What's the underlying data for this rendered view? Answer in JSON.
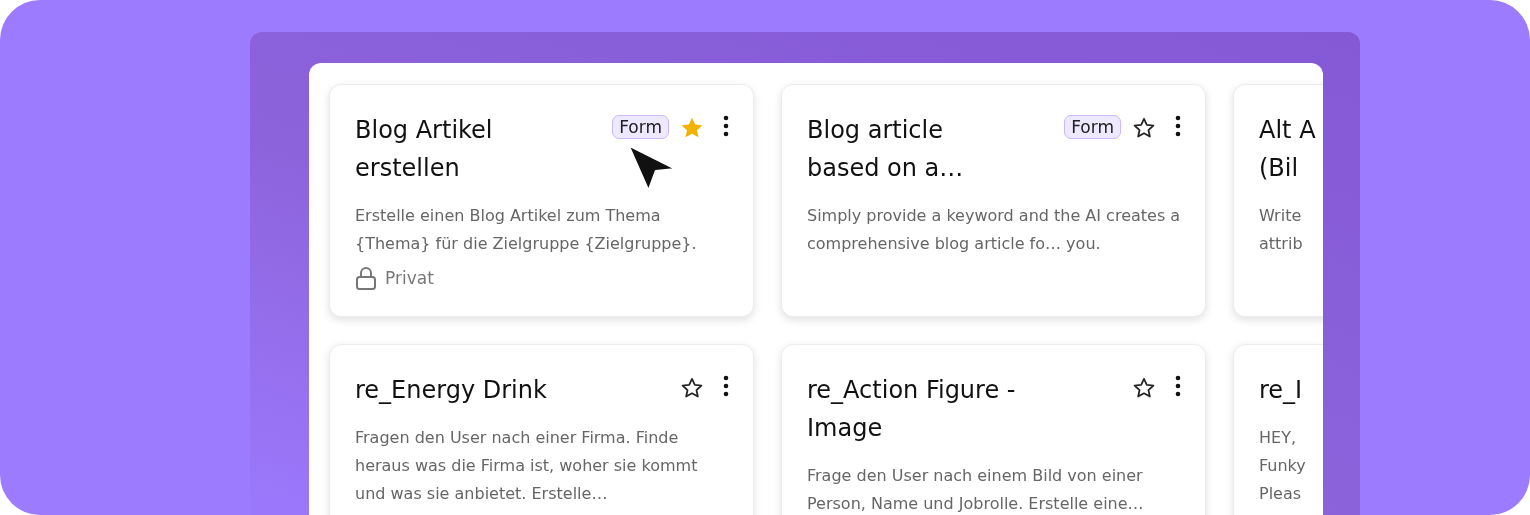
{
  "cards": [
    {
      "title": "Blog Artikel erstellen",
      "tag": "Form",
      "favorite": true,
      "description": "Erstelle einen Blog Artikel zum Thema {Thema} für die Zielgruppe {Zielgruppe}.",
      "visibility": "Privat"
    },
    {
      "title": "Blog article based on a…",
      "tag": "Form",
      "favorite": false,
      "description": "Simply provide a keyword and the AI creates a comprehensive blog article fo… you."
    },
    {
      "title_lines": [
        "Alt A",
        "(Bil"
      ],
      "description_lines": [
        "Write",
        "attrib"
      ]
    },
    {
      "title": "re_Energy Drink",
      "favorite": false,
      "description": "Fragen den User nach einer Firma. Finde heraus was die Firma ist, woher sie kommt und was sie anbietet. Erstelle…"
    },
    {
      "title": "re_Action Figure - Image",
      "favorite": false,
      "description": "Frage den User nach einem Bild von einer Person, Name und Jobrolle. Erstelle eine…"
    },
    {
      "title_lines": [
        "re_I"
      ],
      "description_lines": [
        "HEY,",
        "Funky",
        "Pleas"
      ]
    }
  ]
}
